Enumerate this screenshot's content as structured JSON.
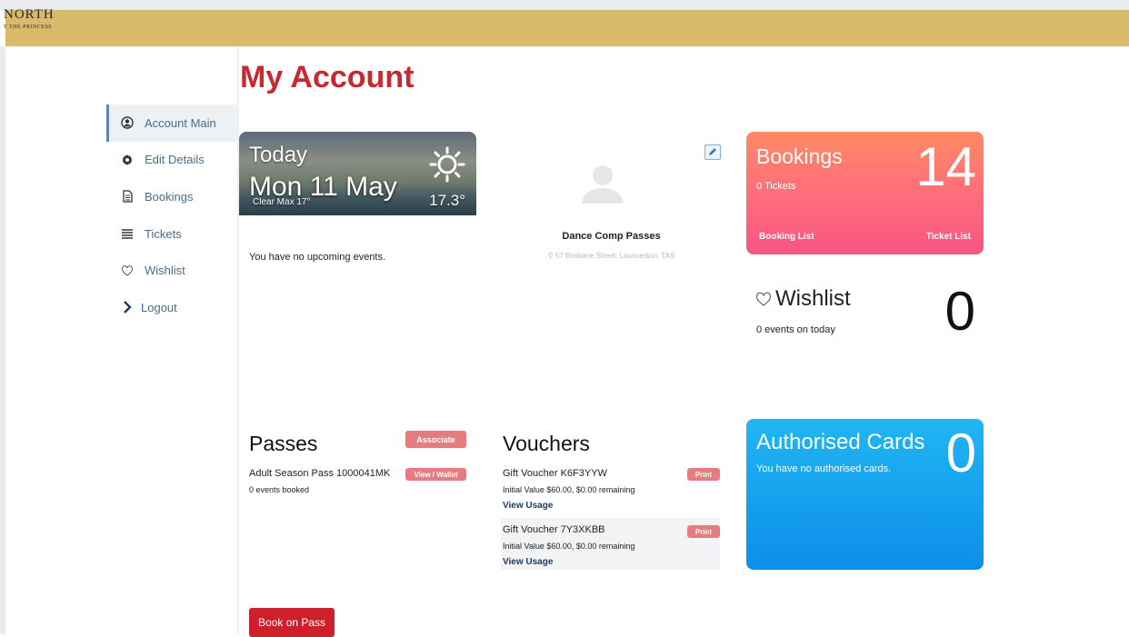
{
  "header": {
    "logo_line1": "NORTH",
    "logo_line2": "T THE PRINCESS"
  },
  "page_title": "My Account",
  "sidebar": {
    "items": [
      {
        "label": "Account Main",
        "icon": "user-circle-icon"
      },
      {
        "label": "Edit Details",
        "icon": "gear-icon"
      },
      {
        "label": "Bookings",
        "icon": "document-icon"
      },
      {
        "label": "Tickets",
        "icon": "list-icon"
      },
      {
        "label": "Wishlist",
        "icon": "heart-icon"
      },
      {
        "label": "Logout",
        "icon": "chevron-right-icon"
      }
    ]
  },
  "weather": {
    "heading": "Today",
    "date": "Mon 11 May",
    "condition": "Clear Max 17°",
    "temp": "17.3°"
  },
  "events": {
    "empty_text": "You have no upcoming events."
  },
  "profile": {
    "name": "Dance Comp Passes",
    "address": "57 Brisbane Street, Launceston, TAS"
  },
  "bookings": {
    "title": "Bookings",
    "count": "14",
    "subtitle": "0 Tickets",
    "booking_list": "Booking List",
    "ticket_list": "Ticket List"
  },
  "wishlist": {
    "title": "Wishlist",
    "count": "0",
    "subtitle": "0 events on today"
  },
  "passes": {
    "title": "Passes",
    "associate": "Associate",
    "item_name": "Adult Season Pass 1000041MK",
    "item_action": "View / Wallet",
    "item_sub": "0 events booked"
  },
  "vouchers": {
    "title": "Vouchers",
    "items": [
      {
        "name": "Gift Voucher K6F3YYW",
        "action": "Print",
        "value": "Initial Value $60.00, $0.00 remaining",
        "link": "View Usage"
      },
      {
        "name": "Gift Voucher 7Y3XKBB",
        "action": "Print",
        "value": "Initial Value $60.00, $0.00 remaining",
        "link": "View Usage"
      }
    ]
  },
  "authorised_cards": {
    "title": "Authorised Cards",
    "count": "0",
    "subtitle": "You have no authorised cards."
  },
  "book_on_pass": "Book on Pass",
  "colors": {
    "header": "#d9b96a",
    "title": "#c8282f",
    "pill": "#e77c80",
    "book_button": "#cf1f2b",
    "sidebar_text": "#4a6c8a"
  }
}
